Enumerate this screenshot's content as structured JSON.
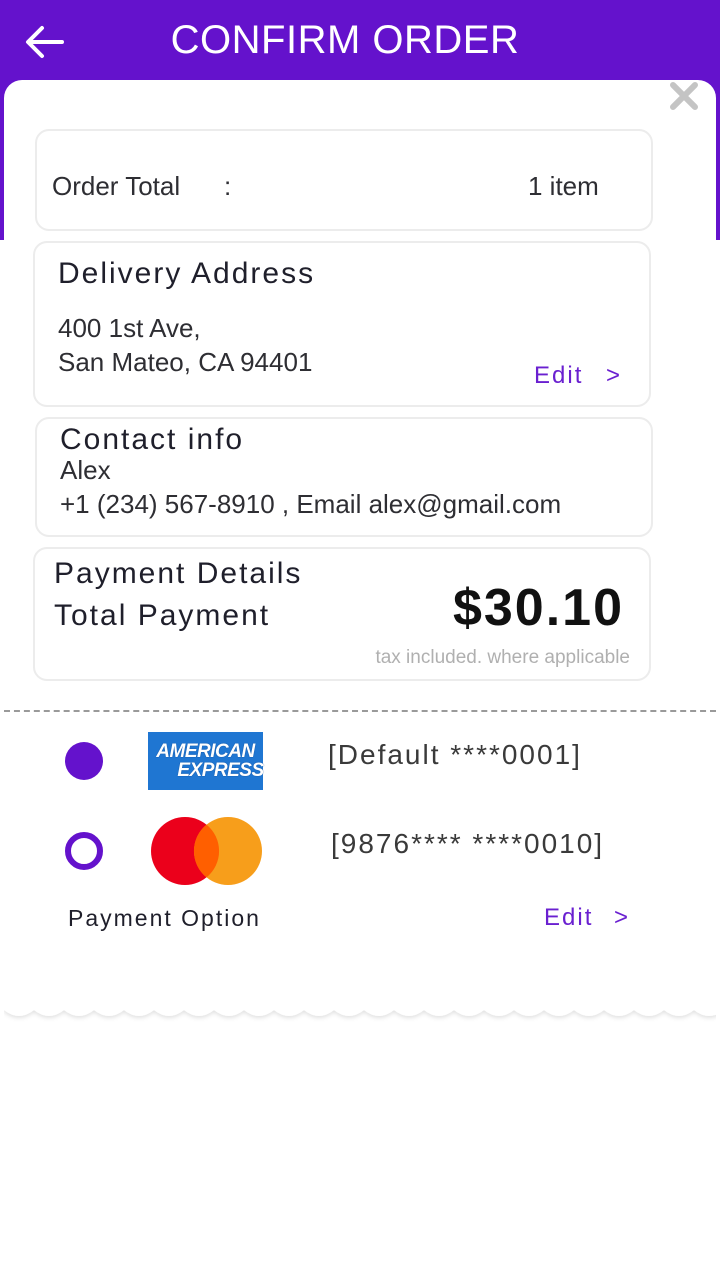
{
  "header": {
    "title": "CONFIRM ORDER",
    "back_icon": "arrow-left-icon",
    "close_icon": "close-icon"
  },
  "order_total": {
    "label": "Order Total",
    "separator": ":",
    "value": "1 item"
  },
  "delivery": {
    "heading": "Delivery Address",
    "line1": "400 1st Ave,",
    "line2": "San Mateo, CA 94401",
    "edit_label": "Edit",
    "edit_chevron": ">"
  },
  "contact": {
    "heading": "Contact info",
    "name": "Alex",
    "details": "+1 (234) 567-8910 ,  Email alex@gmail.com"
  },
  "payment": {
    "heading": "Payment Details",
    "total_label": "Total Payment",
    "total_value": "$30.10",
    "tax_note": "tax included. where applicable"
  },
  "payment_options": {
    "cards": [
      {
        "brand_line1": "AMERICAN",
        "brand_line2": "EXPRESS",
        "label": "[Default ****0001]",
        "selected": true
      },
      {
        "label": "[9876**** ****0010]",
        "selected": false
      }
    ],
    "option_label": "Payment Option",
    "edit_label": "Edit",
    "edit_chevron": ">"
  },
  "colors": {
    "primary": "#6412CC",
    "amex_blue": "#1F76D2",
    "mastercard_red": "#EB001B",
    "mastercard_orange": "#F79E1B"
  }
}
